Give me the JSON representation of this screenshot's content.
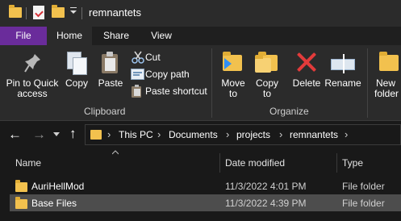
{
  "window": {
    "title": "remnantets"
  },
  "ribbon_tabs": [
    "File",
    "Home",
    "Share",
    "View"
  ],
  "ribbon": {
    "clipboard": {
      "group_label": "Clipboard",
      "pin_line1": "Pin to Quick",
      "pin_line2": "access",
      "copy": "Copy",
      "paste": "Paste",
      "cut": "Cut",
      "copy_path": "Copy path",
      "paste_shortcut": "Paste shortcut"
    },
    "organize": {
      "group_label": "Organize",
      "move_to_line1": "Move",
      "move_to_line2": "to",
      "copy_to_line1": "Copy",
      "copy_to_line2": "to",
      "delete": "Delete",
      "rename": "Rename"
    },
    "new": {
      "new_folder_line1": "New",
      "new_folder_line2": "folder"
    }
  },
  "address": {
    "crumbs": [
      "This PC",
      "Documents",
      "projects",
      "remnantets"
    ],
    "separator": "›"
  },
  "columns": {
    "name": "Name",
    "date_modified": "Date modified",
    "type": "Type"
  },
  "files": [
    {
      "name": "AuriHellMod",
      "date": "11/3/2022 4:01 PM",
      "type": "File folder",
      "selected": false
    },
    {
      "name": "Base Files",
      "date": "11/3/2022 4:39 PM",
      "type": "File folder",
      "selected": true
    }
  ],
  "colors": {
    "file_tab": "#6a2c9b",
    "folder": "#f2c14e",
    "selection": "#4d4d4d",
    "delete_red": "#e23b3b",
    "accent_blue": "#2f8ef5"
  }
}
